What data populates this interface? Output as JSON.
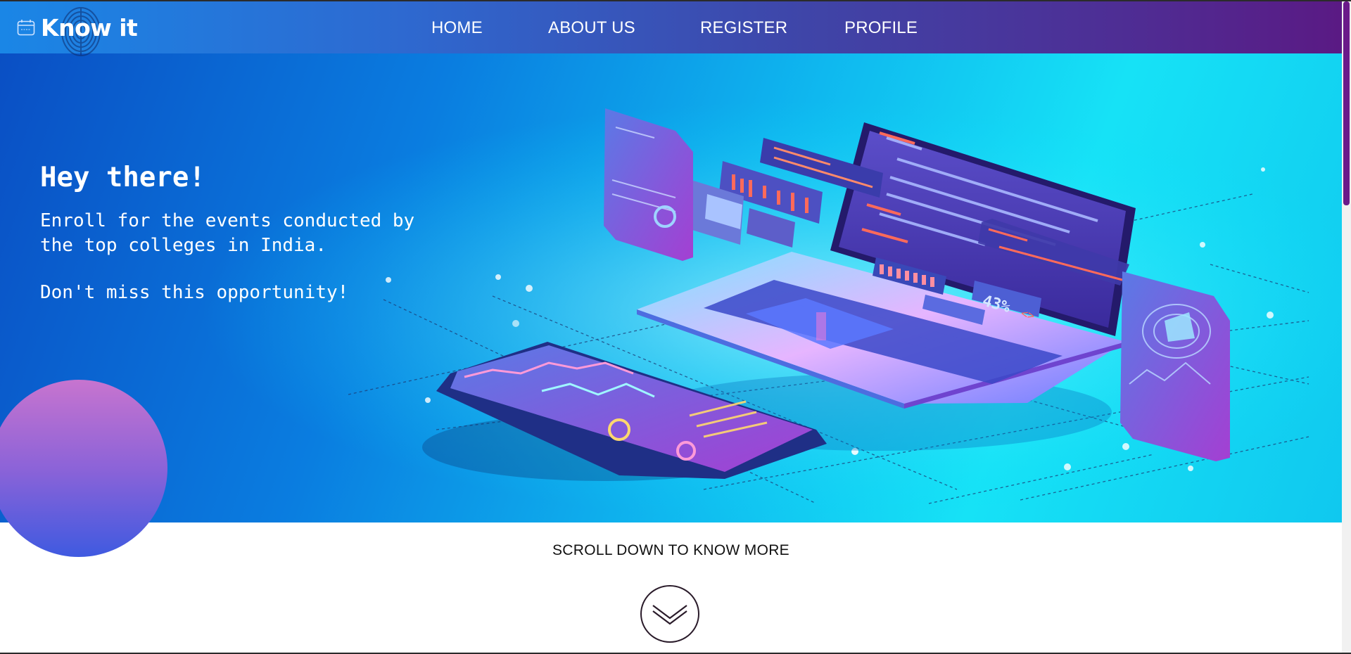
{
  "brand": {
    "name": "Know it",
    "icon": "calendar-icon"
  },
  "nav": {
    "items": [
      {
        "label": "HOME"
      },
      {
        "label": "ABOUT US"
      },
      {
        "label": "REGISTER"
      },
      {
        "label": "PROFILE"
      }
    ]
  },
  "hero": {
    "title": "Hey there!",
    "line1": "Enroll for the events conducted by",
    "line2": "the top colleges in India.",
    "line3": "Don't miss this opportunity!",
    "illustration_badge": "43%",
    "illustration_code_glyph": "<>"
  },
  "scroll": {
    "text": "SCROLL DOWN TO KNOW MORE",
    "icon": "chevron-down-icon"
  },
  "colors": {
    "nav_start": "#1a86e6",
    "nav_end": "#5a1a84",
    "hero_start": "#0a4fc4",
    "hero_end": "#16e2f6",
    "circle_top": "#c774cf",
    "circle_bottom": "#3f5ae0"
  }
}
